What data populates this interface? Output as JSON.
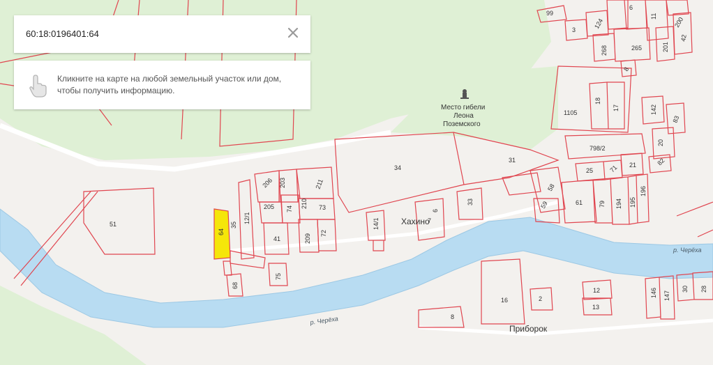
{
  "search": {
    "cadastral_number": "60:18:0196401:64"
  },
  "hint": {
    "text": "Кликните на карте на любой земельный участок или дом, чтобы получить информацию."
  },
  "icons": {
    "close": "close-icon",
    "hand": "hand-pointer-icon",
    "monument": "monument-icon"
  },
  "colors": {
    "plot_border": "#e0454f",
    "selected_plot": "#f5e60a",
    "forest": "#dff0d5",
    "river": "#b8dcf2",
    "land": "#f3f1ee"
  },
  "places": {
    "khakhino": "Хахино",
    "priborok": "Приборок",
    "monument_line1": "Место гибели",
    "monument_line2": "Леона",
    "monument_line3": "Поземского",
    "river_right": "р. Черёха",
    "river_bottom": "р. Черёха"
  },
  "plots": {
    "p51": "51",
    "p64": "64",
    "p35": "35",
    "p12_1": "12/1",
    "p41": "41",
    "p205": "205",
    "p206": "206",
    "p203": "203",
    "p74": "74",
    "p210": "210",
    "p211": "211",
    "p73": "73",
    "p209": "209",
    "p72": "72",
    "p68": "68",
    "p75": "75",
    "p14_1": "14/1",
    "p6": "6",
    "p7": "7",
    "p33": "33",
    "p34": "34",
    "p31": "31",
    "p1105": "1105",
    "p18": "18",
    "p17": "17",
    "p142": "142",
    "p83": "83",
    "p20": "20",
    "p82": "82",
    "p798_2": "798/2",
    "p25": "25",
    "p71": "71",
    "p21": "21",
    "p58": "58",
    "p59": "59",
    "p61": "61",
    "p79": "79",
    "p194": "194",
    "p195": "195",
    "p196": "196",
    "p99": "99",
    "p3": "3",
    "p124": "124",
    "p268": "268",
    "p6b": "6",
    "p11": "11",
    "p265": "265",
    "p201": "201",
    "p42": "42",
    "p200": "200",
    "p8": "8",
    "p16": "16",
    "p2": "2",
    "p12": "12",
    "p13": "13",
    "p146": "146",
    "p147": "147",
    "p30": "30",
    "p28": "28",
    "p8b": "8"
  }
}
